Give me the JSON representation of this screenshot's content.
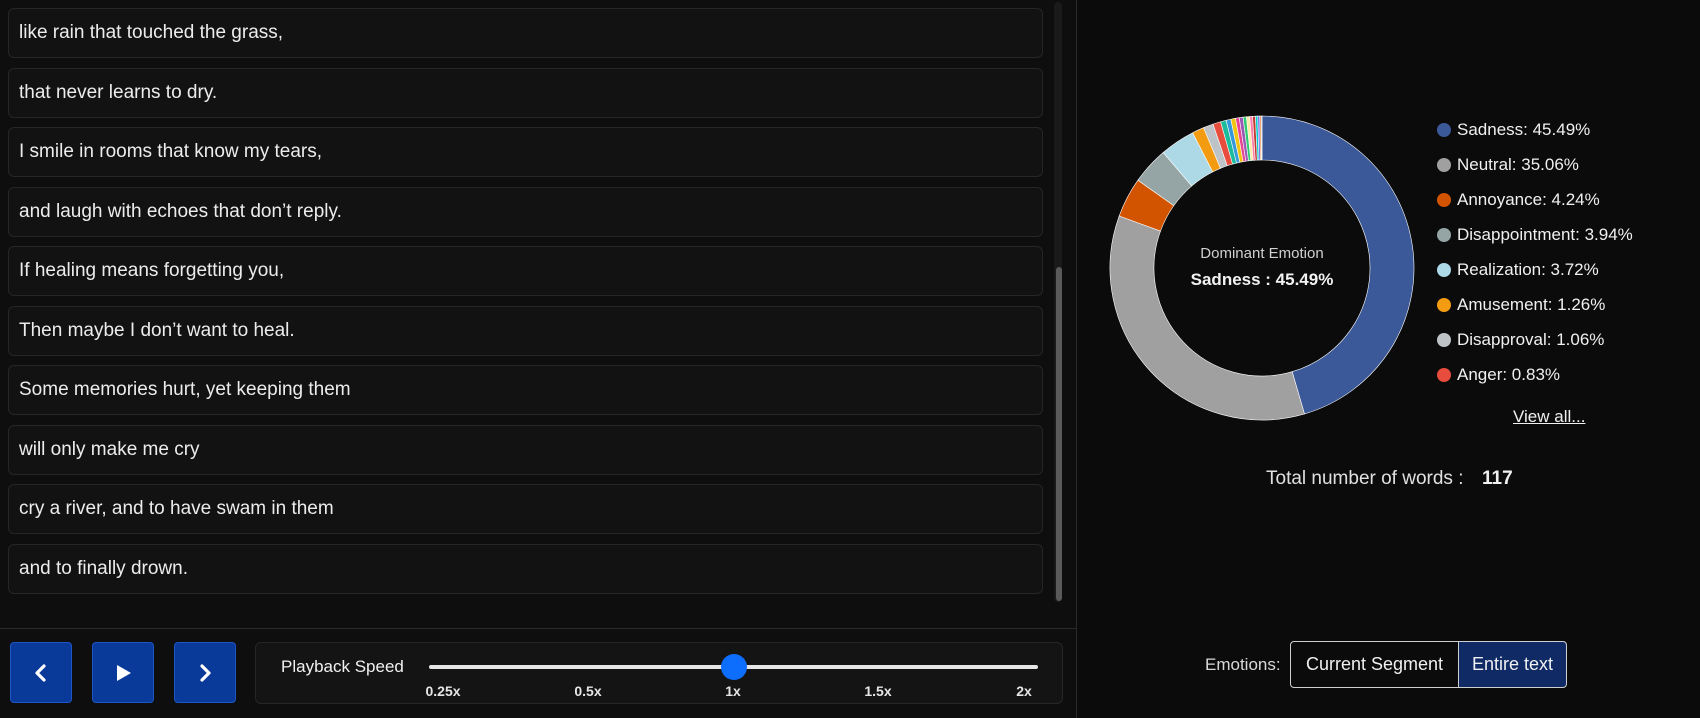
{
  "lyrics": [
    "like rain that touched the grass,",
    "that never learns to dry.",
    "I smile in rooms that know my tears,",
    "and laugh with echoes that don’t reply.",
    "If healing means forgetting you,",
    "Then maybe I don’t want to heal.",
    "Some memories hurt, yet keeping them",
    "will only make me cry",
    "cry a river, and to have swam in them",
    "and to finally drown."
  ],
  "controls": {
    "prev_icon": "chevron-left-icon",
    "play_icon": "play-icon",
    "next_icon": "chevron-right-icon",
    "speed_label": "Playback Speed",
    "speed_ticks": [
      "0.25x",
      "0.5x",
      "1x",
      "1.5x",
      "2x"
    ],
    "speed_selected": "1x"
  },
  "chart_data": {
    "type": "pie",
    "donut": true,
    "center_title": "Dominant Emotion",
    "center_value": "Sadness : 45.49%",
    "slices": [
      {
        "name": "Sadness",
        "value": 45.49,
        "label": "Sadness: 45.49%",
        "color": "#3b5998"
      },
      {
        "name": "Neutral",
        "value": 35.06,
        "label": "Neutral: 35.06%",
        "color": "#a0a0a0"
      },
      {
        "name": "Annoyance",
        "value": 4.24,
        "label": "Annoyance: 4.24%",
        "color": "#d35400"
      },
      {
        "name": "Disappointment",
        "value": 3.94,
        "label": "Disappointment: 3.94%",
        "color": "#95a5a6"
      },
      {
        "name": "Realization",
        "value": 3.72,
        "label": "Realization: 3.72%",
        "color": "#add8e6"
      },
      {
        "name": "Amusement",
        "value": 1.26,
        "label": "Amusement: 1.26%",
        "color": "#f39c12"
      },
      {
        "name": "Disapproval",
        "value": 1.06,
        "label": "Disapproval: 1.06%",
        "color": "#bdc3c7"
      },
      {
        "name": "Anger",
        "value": 0.83,
        "label": "Anger: 0.83%",
        "color": "#e74c3c"
      }
    ],
    "minor_slices": [
      {
        "value": 0.6,
        "color": "#1abc9c"
      },
      {
        "value": 0.5,
        "color": "#3498db"
      },
      {
        "value": 0.5,
        "color": "#f1c40f"
      },
      {
        "value": 0.4,
        "color": "#e84393"
      },
      {
        "value": 0.4,
        "color": "#9b59b6"
      },
      {
        "value": 0.35,
        "color": "#2ecc71"
      },
      {
        "value": 0.35,
        "color": "#ffeaa7"
      },
      {
        "value": 0.3,
        "color": "#fd79a8"
      },
      {
        "value": 0.3,
        "color": "#c0392b"
      },
      {
        "value": 0.25,
        "color": "#00cec9"
      },
      {
        "value": 0.2,
        "color": "#6c5ce7"
      },
      {
        "value": 0.15,
        "color": "#e67e22"
      },
      {
        "value": 0.09,
        "color": "#7f8c8d"
      }
    ]
  },
  "view_all": "View all...",
  "total": {
    "label": "Total number of words :",
    "value": "117"
  },
  "emotions_toggle": {
    "label": "Emotions:",
    "current_segment": "Current Segment",
    "entire_text": "Entire text",
    "selected": "Entire text"
  }
}
